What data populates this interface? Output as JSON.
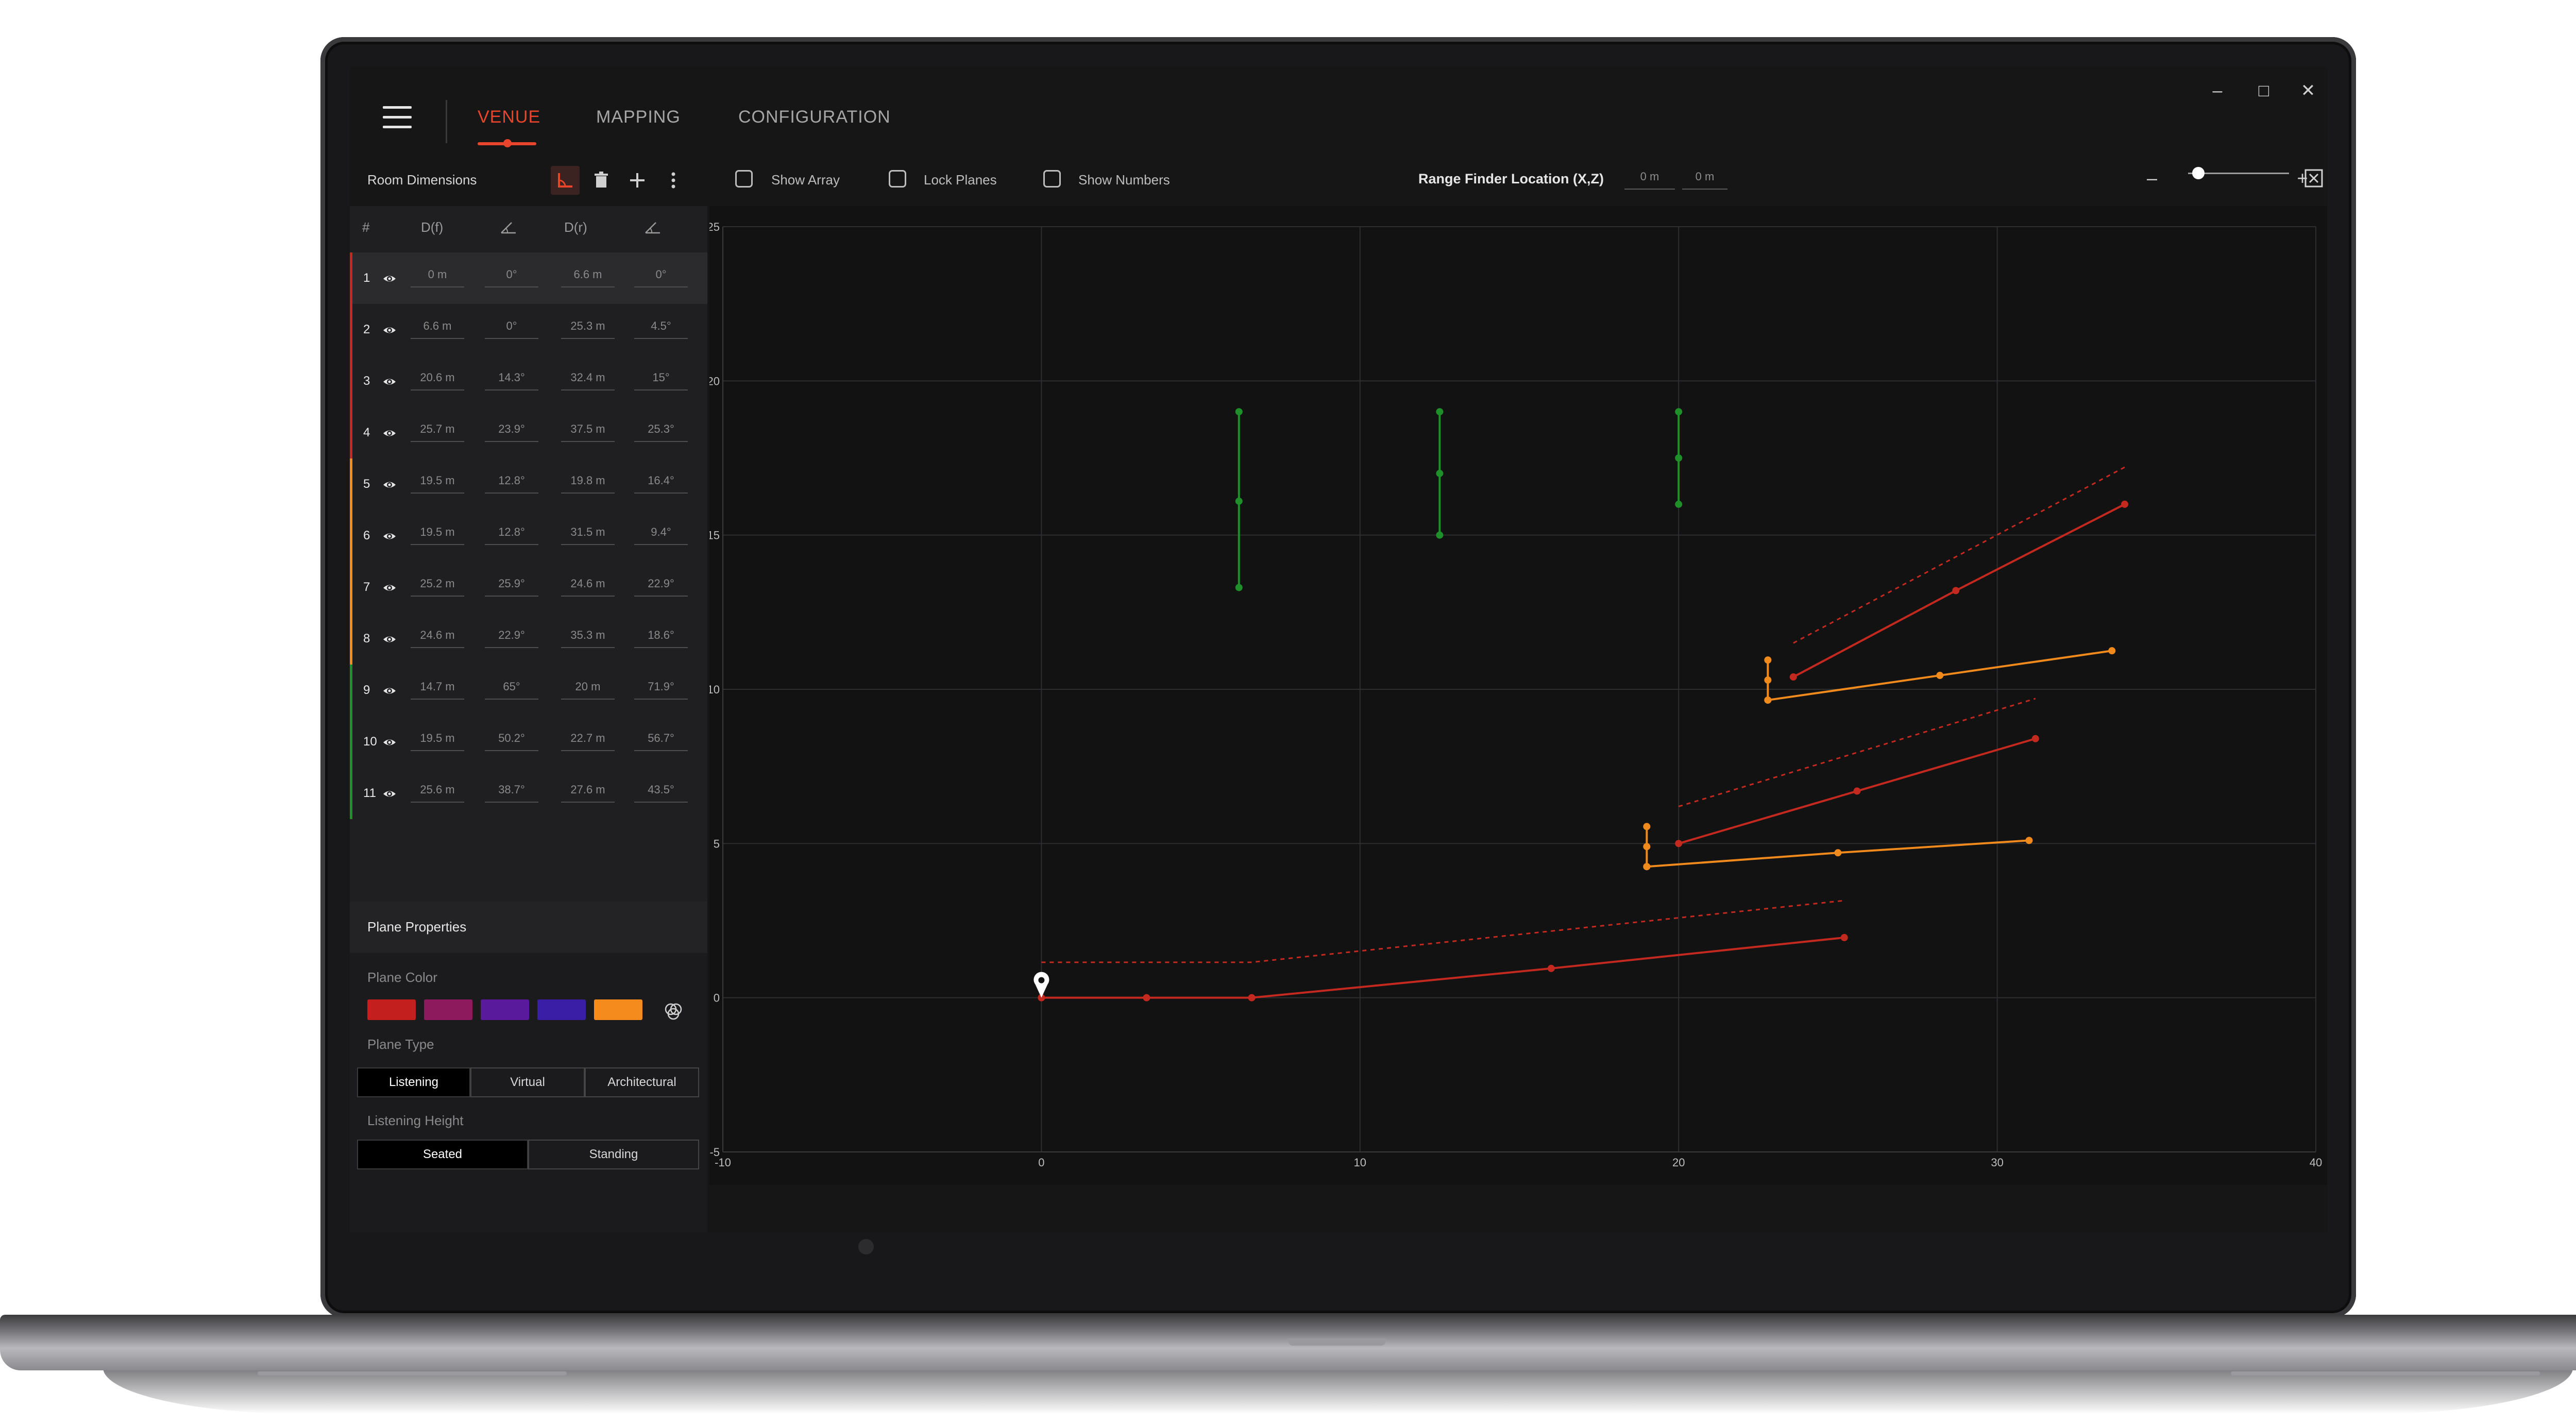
{
  "window_controls": {
    "minimize": "–",
    "maximize": "□",
    "close": "✕"
  },
  "tabs": [
    {
      "label": "VENUE"
    },
    {
      "label": "MAPPING"
    },
    {
      "label": "CONFIGURATION"
    }
  ],
  "toolbar": {
    "room_dimensions": "Room Dimensions",
    "show_array": "Show Array",
    "lock_planes": "Lock Planes",
    "show_numbers": "Show Numbers",
    "range_finder_label": "Range Finder Location (X,Z)",
    "range_finder_x": "0 m",
    "range_finder_z": "0 m",
    "zoom_minus": "–",
    "zoom_plus": "+",
    "zoom_level": 0.1
  },
  "table": {
    "headers": [
      "#",
      "D(f)",
      "D(r)"
    ],
    "rows": [
      {
        "num": "1",
        "df": "0 m",
        "af": "0°",
        "dr": "6.6 m",
        "ar": "0°",
        "color": "#c4291f"
      },
      {
        "num": "2",
        "df": "6.6 m",
        "af": "0°",
        "dr": "25.3 m",
        "ar": "4.5°",
        "color": "#c4291f"
      },
      {
        "num": "3",
        "df": "20.6 m",
        "af": "14.3°",
        "dr": "32.4 m",
        "ar": "15°",
        "color": "#c4291f"
      },
      {
        "num": "4",
        "df": "25.7 m",
        "af": "23.9°",
        "dr": "37.5 m",
        "ar": "25.3°",
        "color": "#c4291f"
      },
      {
        "num": "5",
        "df": "19.5 m",
        "af": "12.8°",
        "dr": "19.8 m",
        "ar": "16.4°",
        "color": "#f08a1c"
      },
      {
        "num": "6",
        "df": "19.5 m",
        "af": "12.8°",
        "dr": "31.5 m",
        "ar": "9.4°",
        "color": "#f08a1c"
      },
      {
        "num": "7",
        "df": "25.2 m",
        "af": "25.9°",
        "dr": "24.6 m",
        "ar": "22.9°",
        "color": "#f08a1c"
      },
      {
        "num": "8",
        "df": "24.6 m",
        "af": "22.9°",
        "dr": "35.3 m",
        "ar": "18.6°",
        "color": "#f08a1c"
      },
      {
        "num": "9",
        "df": "14.7 m",
        "af": "65°",
        "dr": "20 m",
        "ar": "71.9°",
        "color": "#1f8f2a"
      },
      {
        "num": "10",
        "df": "19.5 m",
        "af": "50.2°",
        "dr": "22.7 m",
        "ar": "56.7°",
        "color": "#1f8f2a"
      },
      {
        "num": "11",
        "df": "25.6 m",
        "af": "38.7°",
        "dr": "27.6 m",
        "ar": "43.5°",
        "color": "#1f8f2a"
      }
    ]
  },
  "properties": {
    "title": "Plane Properties",
    "plane_color_label": "Plane Color",
    "colors": [
      "#c41f1f",
      "#8e1a5e",
      "#5a1a9c",
      "#3a1ea6",
      "#f58a1d"
    ],
    "plane_type_label": "Plane Type",
    "plane_types": [
      "Listening",
      "Virtual",
      "Architectural"
    ],
    "listening_height_label": "Listening Height",
    "heights": [
      "Seated",
      "Standing"
    ]
  },
  "chart_data": {
    "type": "line",
    "xlim": [
      -10,
      40
    ],
    "ylim": [
      -5,
      25
    ],
    "x_ticks": [
      "-10",
      "0",
      "10",
      "20",
      "30",
      "40"
    ],
    "y_ticks": [
      "-5",
      "0",
      "5",
      "10",
      "15",
      "20",
      "25"
    ],
    "grid": true,
    "series": [
      {
        "color": "#c4291f",
        "dashed": false,
        "points": [
          [
            0,
            0
          ],
          [
            3.3,
            0
          ],
          [
            6.6,
            0
          ],
          [
            16,
            0.95
          ],
          [
            25.2,
            1.95
          ]
        ]
      },
      {
        "color": "#c4291f",
        "dashed": true,
        "points": [
          [
            0,
            1.15
          ],
          [
            6.6,
            1.15
          ],
          [
            25.2,
            3.15
          ]
        ]
      },
      {
        "color": "#f08a1c",
        "dashed": false,
        "points": [
          [
            19,
            4.25
          ],
          [
            25,
            4.7
          ],
          [
            31,
            5.1
          ]
        ]
      },
      {
        "color": "#f08a1c",
        "dashed": false,
        "points": [
          [
            19,
            4.25
          ],
          [
            19,
            4.9
          ],
          [
            19,
            5.55
          ]
        ]
      },
      {
        "color": "#c4291f",
        "dashed": false,
        "points": [
          [
            20,
            5.0
          ],
          [
            25.6,
            6.7
          ],
          [
            31.2,
            8.4
          ]
        ]
      },
      {
        "color": "#c4291f",
        "dashed": true,
        "points": [
          [
            20,
            6.2
          ],
          [
            31.2,
            9.7
          ]
        ]
      },
      {
        "color": "#f08a1c",
        "dashed": false,
        "points": [
          [
            22.8,
            9.65
          ],
          [
            28.2,
            10.45
          ],
          [
            33.6,
            11.25
          ]
        ]
      },
      {
        "color": "#f08a1c",
        "dashed": false,
        "points": [
          [
            22.8,
            9.65
          ],
          [
            22.8,
            10.3
          ],
          [
            22.8,
            10.95
          ]
        ]
      },
      {
        "color": "#c4291f",
        "dashed": false,
        "points": [
          [
            23.6,
            10.4
          ],
          [
            28.7,
            13.2
          ],
          [
            34,
            16
          ]
        ]
      },
      {
        "color": "#c4291f",
        "dashed": true,
        "points": [
          [
            23.6,
            11.5
          ],
          [
            34,
            17.2
          ]
        ]
      },
      {
        "color": "#1f8f2a",
        "dashed": false,
        "points": [
          [
            6.2,
            13.3
          ],
          [
            6.2,
            16.1
          ],
          [
            6.2,
            19
          ]
        ]
      },
      {
        "color": "#1f8f2a",
        "dashed": false,
        "points": [
          [
            12.5,
            15
          ],
          [
            12.5,
            17
          ],
          [
            12.5,
            19
          ]
        ]
      },
      {
        "color": "#1f8f2a",
        "dashed": false,
        "points": [
          [
            20,
            16
          ],
          [
            20,
            17.5
          ],
          [
            20,
            19
          ]
        ]
      }
    ],
    "marker": [
      0,
      0
    ]
  }
}
